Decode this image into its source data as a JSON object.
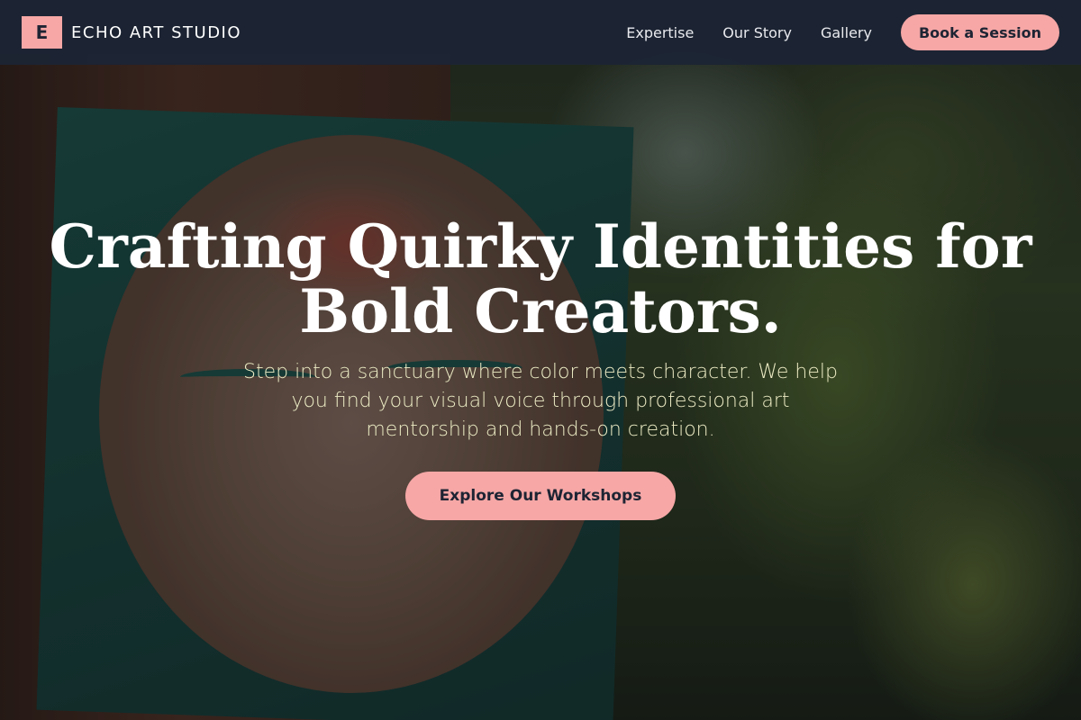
{
  "brand": {
    "mark": "E",
    "name": "ECHO ART STUDIO"
  },
  "nav": {
    "links": [
      "Expertise",
      "Our Story",
      "Gallery"
    ],
    "cta_label": "Book a Session"
  },
  "hero": {
    "title": "Crafting Quirky Identities for Bold Creators.",
    "subtitle": "Step into a sanctuary where color meets character. We help you find your visual voice through professional art mentorship and hands-on creation.",
    "cta_label": "Explore Our Workshops",
    "background": "painted-face-board-in-garden-photo"
  },
  "colors": {
    "accent": "#f6a7a6",
    "nav_bg": "#1c2434",
    "subtitle_text": "#ecebc4",
    "title_text": "#ffffff"
  }
}
